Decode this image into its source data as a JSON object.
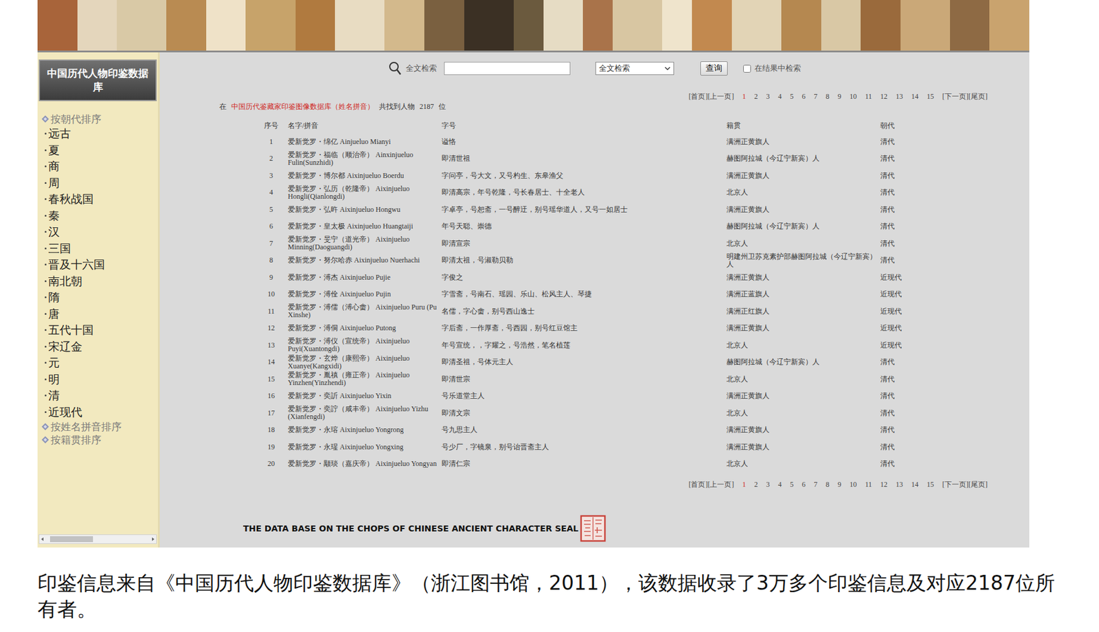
{
  "sidebar": {
    "title": "中国历代人物印鉴数据库",
    "groups": [
      {
        "label": "按朝代排序",
        "expanded": true,
        "items": [
          "远古",
          "夏",
          "商",
          "周",
          "春秋战国",
          "秦",
          "汉",
          "三国",
          "晋及十六国",
          "南北朝",
          "隋",
          "唐",
          "五代十国",
          "宋辽金",
          "元",
          "明",
          "清",
          "近现代"
        ]
      },
      {
        "label": "按姓名拼音排序",
        "expanded": false,
        "items": []
      },
      {
        "label": "按籍贯排序",
        "expanded": false,
        "items": []
      }
    ]
  },
  "search": {
    "label": "全文检索",
    "value": "",
    "select": "全文检索",
    "button": "查询",
    "within_results": {
      "label": "在结果中检索",
      "checked": false
    }
  },
  "pagination": {
    "first": "[首页]",
    "prev": "[上一页]",
    "pages": [
      {
        "label": "1",
        "selected": true
      },
      {
        "label": "2",
        "selected": false
      },
      {
        "label": "3",
        "selected": false
      },
      {
        "label": "4",
        "selected": false
      },
      {
        "label": "5",
        "selected": false
      },
      {
        "label": "6",
        "selected": false
      },
      {
        "label": "7",
        "selected": false
      },
      {
        "label": "8",
        "selected": false
      },
      {
        "label": "9",
        "selected": false
      },
      {
        "label": "10",
        "selected": false
      },
      {
        "label": "11",
        "selected": false
      },
      {
        "label": "12",
        "selected": false
      },
      {
        "label": "13",
        "selected": false
      },
      {
        "label": "14",
        "selected": false
      },
      {
        "label": "15",
        "selected": false
      }
    ],
    "next": "[下一页]",
    "last": "[尾页]"
  },
  "summary": {
    "prefix": "在",
    "source": "中国历代鉴藏家印鉴图像数据库（姓名拼音）",
    "middle": "共找到人物",
    "count": "2187",
    "suffix": "位"
  },
  "table": {
    "columns": [
      "序号",
      "名字/拼音",
      "字号",
      "籍贯",
      "朝代"
    ],
    "rows": [
      {
        "no": "1",
        "name": "爱新觉罗・绵亿 Ainjueluo Mianyi",
        "zihao": "谥恪",
        "origin": "满洲正黄旗人",
        "dynasty": "清代"
      },
      {
        "no": "2",
        "name": "爱新觉罗・福临（顺治帝） Ainxinjueluo Fulin(Sunzhidi)",
        "zihao": "即清世祖",
        "origin": "赫图阿拉城（今辽宁新宾）人",
        "dynasty": "清代"
      },
      {
        "no": "3",
        "name": "爱新觉罗・博尔都 Aixinjueluo Boerdu",
        "zihao": "字问亭，号大文，又号杓生、东皋渔父",
        "origin": "满洲正黄旗人",
        "dynasty": "清代"
      },
      {
        "no": "4",
        "name": "爱新觉罗・弘历（乾隆帝） Aixinjueluo Hongli(Qianlongdi)",
        "zihao": "即清高宗，年号乾隆，号长春居士、十全老人",
        "origin": "北京人",
        "dynasty": "清代"
      },
      {
        "no": "5",
        "name": "爱新觉罗・弘旿 Aixinjueluo Hongwu",
        "zihao": "字卓亭，号恕斋，一号醉迂，别号瑶华道人，又号一如居士",
        "origin": "满洲正黄旗人",
        "dynasty": "清代"
      },
      {
        "no": "6",
        "name": "爱新觉罗・皇太极 Aixinjueluo Huangtaiji",
        "zihao": "年号天聪、崇德",
        "origin": "赫图阿拉城（今辽宁新宾）人",
        "dynasty": "清代"
      },
      {
        "no": "7",
        "name": "爱新觉罗・旻宁（道光帝） Aixinjueluo Minning(Daoguangdi)",
        "zihao": "即清宣宗",
        "origin": "北京人",
        "dynasty": "清代"
      },
      {
        "no": "8",
        "name": "爱新觉罗・努尔哈赤 Aixinjueluo Nuerhachi",
        "zihao": "即清太祖，号淑勒贝勒",
        "origin": "明建州卫苏克素护部赫图阿拉城（今辽宁新宾）人",
        "dynasty": "清代"
      },
      {
        "no": "9",
        "name": "爱新觉罗・溥杰 Aixinjueluo Pujie",
        "zihao": "字俊之",
        "origin": "满洲正黄旗人",
        "dynasty": "近现代"
      },
      {
        "no": "10",
        "name": "爱新觉罗・溥佺 Aixinjueluo Pujin",
        "zihao": "字雪斋，号南石、瑶园、乐山、松风主人、琴捷",
        "origin": "满洲正蓝旗人",
        "dynasty": "近现代"
      },
      {
        "no": "11",
        "name": "爱新觉罗・溥儒（溥心畬） Aixinjueluo Puru (Pu Xinshe)",
        "zihao": "名儒，字心畬，别号西山逸士",
        "origin": "满洲正红旗人",
        "dynasty": "近现代"
      },
      {
        "no": "12",
        "name": "爱新觉罗・溥侗 Aixinjueluo Putong",
        "zihao": "字后斋，一作厚斋，号西园，别号红豆馆主",
        "origin": "满洲正黄旗人",
        "dynasty": "近现代"
      },
      {
        "no": "13",
        "name": "爱新觉罗・溥仪（宣统帝） Aixinjueluo Puyi(Xuantongdi)",
        "zihao": "年号宣统，，字耀之，号浩然，笔名植莲",
        "origin": "北京人",
        "dynasty": "近现代"
      },
      {
        "no": "14",
        "name": "爱新觉罗・玄烨（康熙帝） Aixinjueluo Xuanye(Kangxidi)",
        "zihao": "即清圣祖，号体元主人",
        "origin": "赫图阿拉城（今辽宁新宾）人",
        "dynasty": "清代"
      },
      {
        "no": "15",
        "name": "爱新觉罗・胤禛（雍正帝） Aixinjueluo Yinzhen(Yinzhendi)",
        "zihao": "即清世宗",
        "origin": "北京人",
        "dynasty": "清代"
      },
      {
        "no": "16",
        "name": "爱新觉罗・奕訢 Aixinjueluo Yixin",
        "zihao": "号乐道堂主人",
        "origin": "满洲正黄旗人",
        "dynasty": "清代"
      },
      {
        "no": "17",
        "name": "爱新觉罗・奕詝（咸丰帝） Aixinjueluo Yizhu (Xianfengdi)",
        "zihao": "即清文宗",
        "origin": "北京人",
        "dynasty": "清代"
      },
      {
        "no": "18",
        "name": "爱新觉罗・永瑢 Aixinjueluo Yongrong",
        "zihao": "号九思主人",
        "origin": "满洲正黄旗人",
        "dynasty": "清代"
      },
      {
        "no": "19",
        "name": "爱新觉罗・永瑆 Aixinjueluo Yongxing",
        "zihao": "号少厂，字镜泉，别号诒晋斋主人",
        "origin": "满洲正黄旗人",
        "dynasty": "清代"
      },
      {
        "no": "20",
        "name": "爱新觉罗・颙琰（嘉庆帝） Aixinjueluo Yongyan",
        "zihao": "即清仁宗",
        "origin": "北京人",
        "dynasty": "清代"
      }
    ]
  },
  "footer": {
    "text": "THE DATA BASE ON THE CHOPS OF CHINESE ANCIENT CHARACTER SEAL"
  },
  "caption": "印鉴信息来自《中国历代人物印鉴数据库》（浙江图书馆，2011），该数据收录了3万多个印鉴信息及对应2187位所有者。"
}
